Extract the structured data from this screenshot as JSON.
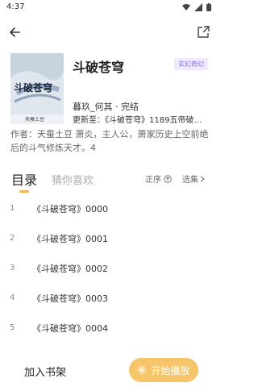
{
  "status_bar": {
    "time": "4:37"
  },
  "book": {
    "title": "斗破苍穹",
    "genre_badge": "玄幻奇幻",
    "author_line": "暮玖_何其 · 完结",
    "update_line": "更新至：《斗破苍穹》1189五帝破…",
    "description": "作者：天蚕土豆 萧炎，主人公，萧家历史上空前绝后的斗气修炼天才。4",
    "cover_text": "斗破苍穹",
    "cover_subtext": "天蚕土豆"
  },
  "tabs": {
    "toc_label": "目录",
    "like_label": "猜你喜欢"
  },
  "toolbar": {
    "sort_label": "正序",
    "select_label": "选集"
  },
  "chapters": [
    {
      "num": "1",
      "name": "《斗破苍穹》0000"
    },
    {
      "num": "2",
      "name": "《斗破苍穹》0001"
    },
    {
      "num": "3",
      "name": "《斗破苍穹》0002"
    },
    {
      "num": "4",
      "name": "《斗破苍穹》0003"
    },
    {
      "num": "5",
      "name": "《斗破苍穹》0004"
    }
  ],
  "bottom": {
    "add_shelf_label": "加入书架",
    "start_label": "开始播放"
  },
  "colors": {
    "accent": "#f6c469",
    "badge": "#8a6bd6",
    "indicator": "#f5b64a"
  }
}
